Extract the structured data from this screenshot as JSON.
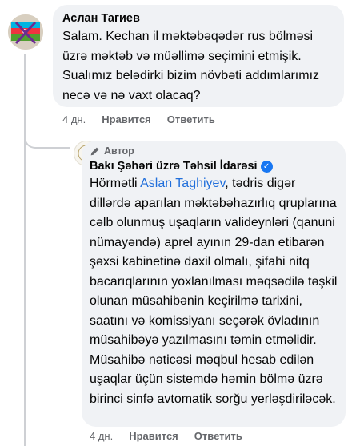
{
  "comment1": {
    "author": "Аслан Тагиев",
    "text": "Salam. Kechan il məktəbəqədər rus bölməsi üzrə məktəb və müəllimə seçimini etmişik. Sualımız belədirki bizim növbəti addımlarımız necə və nə vaxt olacaq?",
    "time": "4 дн.",
    "like": "Нравится",
    "reply": "Ответить"
  },
  "reply": {
    "badge": "Автор",
    "author": "Bakı Şəhəri üzrə Təhsil İdarəsi",
    "text_prefix": "Hörmətli ",
    "mention": "Aslan Taghiyev",
    "text": ", tədris digər dillərdə aparılan məktəbəhazırlıq qruplarına cəlb olunmuş uşaqların valideynləri (qanuni nümayəndə) aprel ayının 29-dan etibarən şəxsi kabinetinə daxil olmalı, şifahi nitq bacarıqlarının yoxlanılması məqsədilə təşkil olunan müsahibənin keçirilmə tarixini, saatını və komissiyanı seçərək övladının müsahibəyə yazılmasını təmin etməlidir. Müsahibə nəticəsi məqbul hesab edilən uşaqlar üçün sistemdə həmin bölmə üzrə birinci sinfə avtomatik sorğu yerləşdiriləcək.",
    "time": "4 дн.",
    "like": "Нравится",
    "reply": "Ответить"
  },
  "icons": {
    "author_badge": "pencil-icon",
    "verified": "verified-check-icon",
    "avatar1": "flag-avatar",
    "avatar2": "emblem-avatar"
  },
  "colors": {
    "bubble": "#f0f2f5",
    "mention": "#216fdb",
    "verified": "#1877f2",
    "meta": "#65676b"
  }
}
